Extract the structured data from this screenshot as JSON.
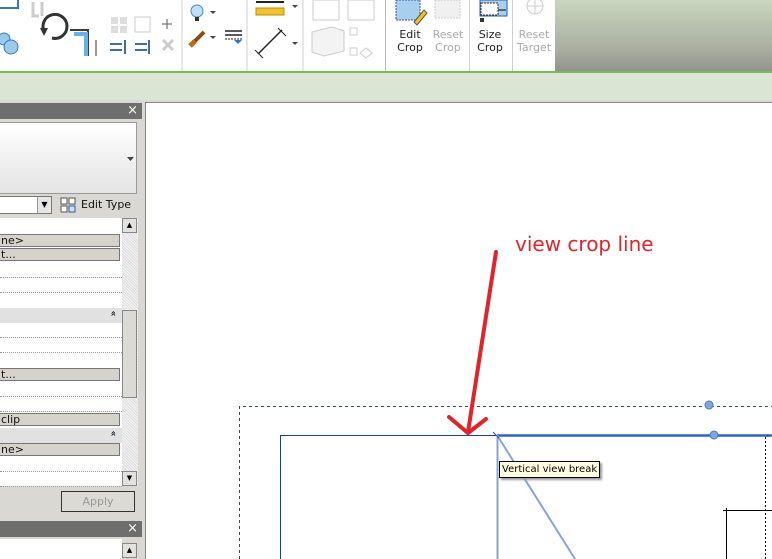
{
  "ribbon": {
    "buttons": [
      {
        "label1": "Edit",
        "label2": "Crop",
        "enabled": true
      },
      {
        "label1": "Reset",
        "label2": "Crop",
        "enabled": false
      },
      {
        "label1": "Size",
        "label2": "Crop",
        "enabled": true
      },
      {
        "label1": "Reset",
        "label2": "Target",
        "enabled": false
      }
    ]
  },
  "properties": {
    "close": "×",
    "edit_type": "Edit Type",
    "apply": "Apply",
    "cells": [
      "ne>",
      "t...",
      "t...",
      "clip",
      "ne>"
    ],
    "collapse": "«"
  },
  "second_panel": {
    "close": "×"
  },
  "canvas": {
    "tooltip": "Vertical view break",
    "annotation": "view crop line",
    "annotation_color": "#e0242b"
  }
}
